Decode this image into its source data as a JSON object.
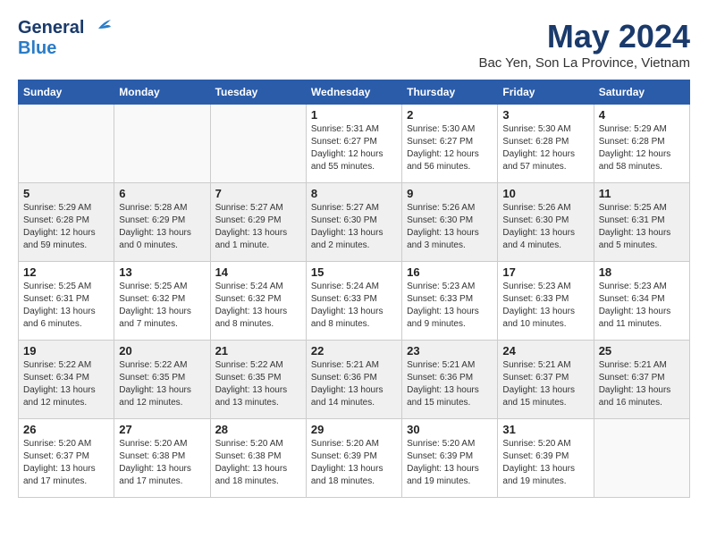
{
  "logo": {
    "line1": "General",
    "line2": "Blue"
  },
  "title": "May 2024",
  "location": "Bac Yen, Son La Province, Vietnam",
  "days_of_week": [
    "Sunday",
    "Monday",
    "Tuesday",
    "Wednesday",
    "Thursday",
    "Friday",
    "Saturday"
  ],
  "weeks": [
    [
      {
        "day": "",
        "info": ""
      },
      {
        "day": "",
        "info": ""
      },
      {
        "day": "",
        "info": ""
      },
      {
        "day": "1",
        "info": "Sunrise: 5:31 AM\nSunset: 6:27 PM\nDaylight: 12 hours\nand 55 minutes."
      },
      {
        "day": "2",
        "info": "Sunrise: 5:30 AM\nSunset: 6:27 PM\nDaylight: 12 hours\nand 56 minutes."
      },
      {
        "day": "3",
        "info": "Sunrise: 5:30 AM\nSunset: 6:28 PM\nDaylight: 12 hours\nand 57 minutes."
      },
      {
        "day": "4",
        "info": "Sunrise: 5:29 AM\nSunset: 6:28 PM\nDaylight: 12 hours\nand 58 minutes."
      }
    ],
    [
      {
        "day": "5",
        "info": "Sunrise: 5:29 AM\nSunset: 6:28 PM\nDaylight: 12 hours\nand 59 minutes."
      },
      {
        "day": "6",
        "info": "Sunrise: 5:28 AM\nSunset: 6:29 PM\nDaylight: 13 hours\nand 0 minutes."
      },
      {
        "day": "7",
        "info": "Sunrise: 5:27 AM\nSunset: 6:29 PM\nDaylight: 13 hours\nand 1 minute."
      },
      {
        "day": "8",
        "info": "Sunrise: 5:27 AM\nSunset: 6:30 PM\nDaylight: 13 hours\nand 2 minutes."
      },
      {
        "day": "9",
        "info": "Sunrise: 5:26 AM\nSunset: 6:30 PM\nDaylight: 13 hours\nand 3 minutes."
      },
      {
        "day": "10",
        "info": "Sunrise: 5:26 AM\nSunset: 6:30 PM\nDaylight: 13 hours\nand 4 minutes."
      },
      {
        "day": "11",
        "info": "Sunrise: 5:25 AM\nSunset: 6:31 PM\nDaylight: 13 hours\nand 5 minutes."
      }
    ],
    [
      {
        "day": "12",
        "info": "Sunrise: 5:25 AM\nSunset: 6:31 PM\nDaylight: 13 hours\nand 6 minutes."
      },
      {
        "day": "13",
        "info": "Sunrise: 5:25 AM\nSunset: 6:32 PM\nDaylight: 13 hours\nand 7 minutes."
      },
      {
        "day": "14",
        "info": "Sunrise: 5:24 AM\nSunset: 6:32 PM\nDaylight: 13 hours\nand 8 minutes."
      },
      {
        "day": "15",
        "info": "Sunrise: 5:24 AM\nSunset: 6:33 PM\nDaylight: 13 hours\nand 8 minutes."
      },
      {
        "day": "16",
        "info": "Sunrise: 5:23 AM\nSunset: 6:33 PM\nDaylight: 13 hours\nand 9 minutes."
      },
      {
        "day": "17",
        "info": "Sunrise: 5:23 AM\nSunset: 6:33 PM\nDaylight: 13 hours\nand 10 minutes."
      },
      {
        "day": "18",
        "info": "Sunrise: 5:23 AM\nSunset: 6:34 PM\nDaylight: 13 hours\nand 11 minutes."
      }
    ],
    [
      {
        "day": "19",
        "info": "Sunrise: 5:22 AM\nSunset: 6:34 PM\nDaylight: 13 hours\nand 12 minutes."
      },
      {
        "day": "20",
        "info": "Sunrise: 5:22 AM\nSunset: 6:35 PM\nDaylight: 13 hours\nand 12 minutes."
      },
      {
        "day": "21",
        "info": "Sunrise: 5:22 AM\nSunset: 6:35 PM\nDaylight: 13 hours\nand 13 minutes."
      },
      {
        "day": "22",
        "info": "Sunrise: 5:21 AM\nSunset: 6:36 PM\nDaylight: 13 hours\nand 14 minutes."
      },
      {
        "day": "23",
        "info": "Sunrise: 5:21 AM\nSunset: 6:36 PM\nDaylight: 13 hours\nand 15 minutes."
      },
      {
        "day": "24",
        "info": "Sunrise: 5:21 AM\nSunset: 6:37 PM\nDaylight: 13 hours\nand 15 minutes."
      },
      {
        "day": "25",
        "info": "Sunrise: 5:21 AM\nSunset: 6:37 PM\nDaylight: 13 hours\nand 16 minutes."
      }
    ],
    [
      {
        "day": "26",
        "info": "Sunrise: 5:20 AM\nSunset: 6:37 PM\nDaylight: 13 hours\nand 17 minutes."
      },
      {
        "day": "27",
        "info": "Sunrise: 5:20 AM\nSunset: 6:38 PM\nDaylight: 13 hours\nand 17 minutes."
      },
      {
        "day": "28",
        "info": "Sunrise: 5:20 AM\nSunset: 6:38 PM\nDaylight: 13 hours\nand 18 minutes."
      },
      {
        "day": "29",
        "info": "Sunrise: 5:20 AM\nSunset: 6:39 PM\nDaylight: 13 hours\nand 18 minutes."
      },
      {
        "day": "30",
        "info": "Sunrise: 5:20 AM\nSunset: 6:39 PM\nDaylight: 13 hours\nand 19 minutes."
      },
      {
        "day": "31",
        "info": "Sunrise: 5:20 AM\nSunset: 6:39 PM\nDaylight: 13 hours\nand 19 minutes."
      },
      {
        "day": "",
        "info": ""
      }
    ]
  ]
}
